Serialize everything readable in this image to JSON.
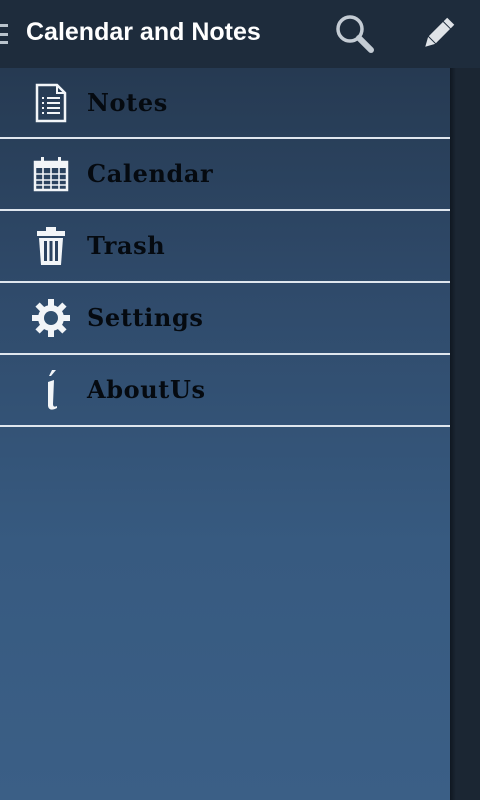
{
  "header": {
    "title": "Calendar and Notes",
    "actions": [
      {
        "name": "search",
        "icon": "search-icon"
      },
      {
        "name": "edit",
        "icon": "pencil-icon"
      }
    ]
  },
  "drawer": {
    "items": [
      {
        "label": "Notes",
        "icon": "notes-icon"
      },
      {
        "label": "Calendar",
        "icon": "calendar-icon"
      },
      {
        "label": "Trash",
        "icon": "trash-icon"
      },
      {
        "label": "Settings",
        "icon": "gear-icon"
      },
      {
        "label": "AboutUs",
        "icon": "info-icon"
      }
    ]
  },
  "colors": {
    "actionbar": "#1e2c3c",
    "drawer_top": "#263a52",
    "drawer_bottom": "#3b5f86",
    "divider": "#dfe6ee",
    "label": "#050a10"
  }
}
